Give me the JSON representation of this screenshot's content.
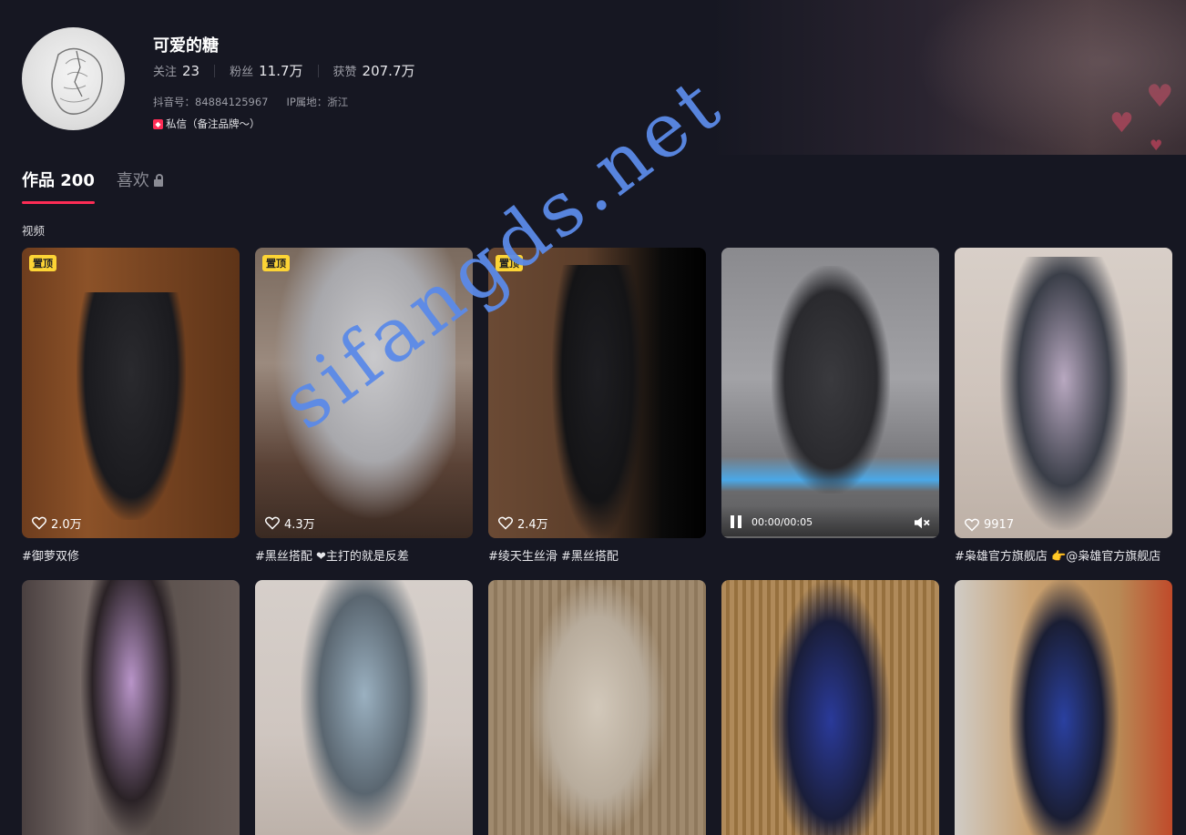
{
  "profile": {
    "nickname": "可爱的糖",
    "stats": [
      {
        "label": "关注",
        "value": "23"
      },
      {
        "label": "粉丝",
        "value": "11.7万"
      },
      {
        "label": "获赞",
        "value": "207.7万"
      }
    ],
    "douyin_id": "抖音号：84884125967",
    "ip_location": "IP属地：浙江",
    "dm_note": "私信（备注品牌～）"
  },
  "tabs": [
    {
      "label": "作品 200"
    },
    {
      "label": "喜欢"
    }
  ],
  "section_label": "视频",
  "videos": [
    {
      "pinned": "置顶",
      "likes": "2.0万",
      "caption": "#御萝双修"
    },
    {
      "pinned": "置顶",
      "likes": "4.3万",
      "caption": "#黑丝搭配 ❤主打的就是反差"
    },
    {
      "pinned": "置顶",
      "likes": "2.4万",
      "caption": "#绫天生丝滑 #黑丝搭配"
    },
    {
      "player_time": "00:00/00:05"
    },
    {
      "likes": "9917",
      "caption": "#枭雄官方旗舰店 👉@枭雄官方旗舰店"
    },
    {},
    {},
    {},
    {},
    {}
  ],
  "watermark": "sifangds.net",
  "colors": {
    "background": "#161722",
    "accent": "#fe2c55",
    "pin_badge": "#fcd435",
    "watermark": "#5b8ae8"
  }
}
